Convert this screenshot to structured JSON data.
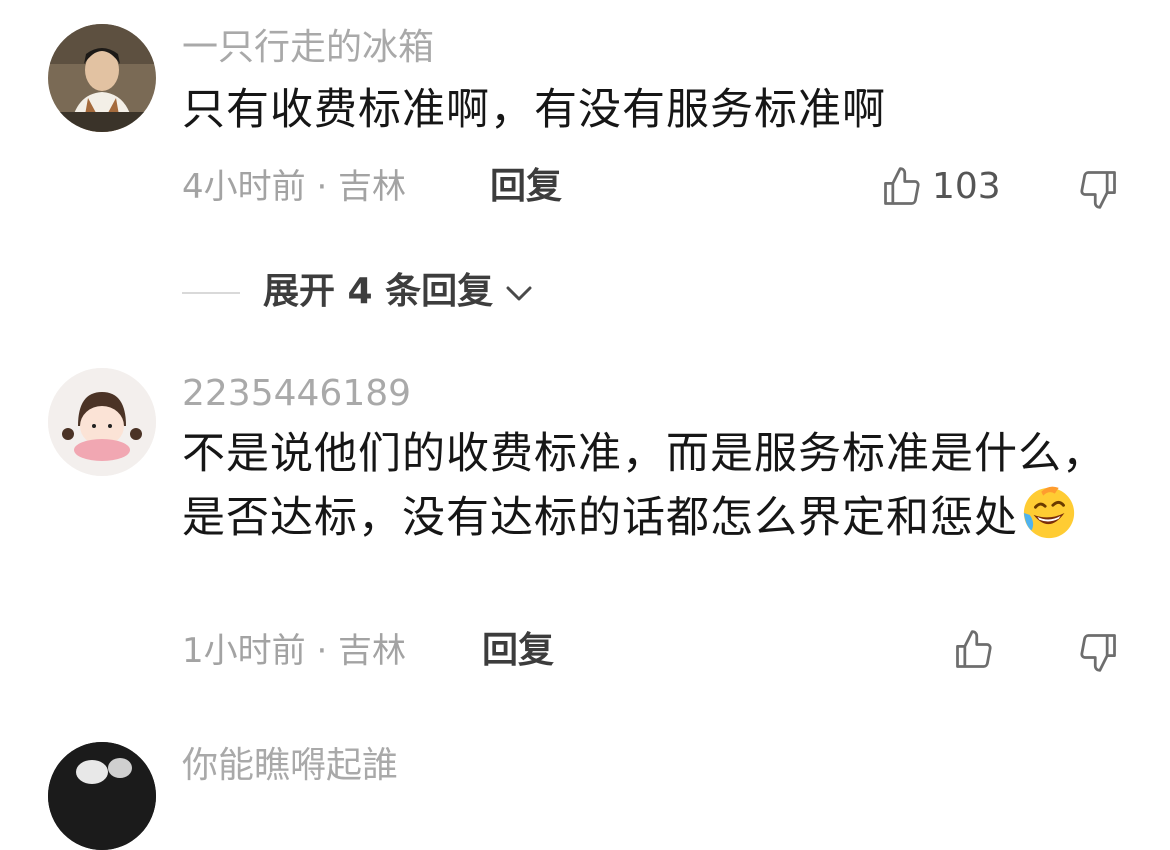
{
  "comments": [
    {
      "username": "一只行走的冰箱",
      "text": "只有收费标准啊，有没有服务标准啊",
      "meta": "4小时前 · 吉林",
      "reply_label": "回复",
      "like_count": "103"
    },
    {
      "username": "2235446189",
      "text": "不是说他们的收费标准，而是服务标准是什么，是否达标，没有达标的话都怎么界定和惩处",
      "emoji": "laughing-crying-emoji",
      "meta": "1小时前 · 吉林",
      "reply_label": "回复",
      "like_count": ""
    },
    {
      "username": "你能瞧嘚起誰"
    }
  ],
  "expand_replies_label": "展开 4 条回复",
  "icons": {
    "like": "thumbs-up-icon",
    "dislike": "thumbs-down-icon",
    "expand": "chevron-down-icon"
  },
  "colors": {
    "username": "#a9a9a9",
    "text": "#161616",
    "meta": "#a3a3a3",
    "reply": "#3c3c3c"
  }
}
